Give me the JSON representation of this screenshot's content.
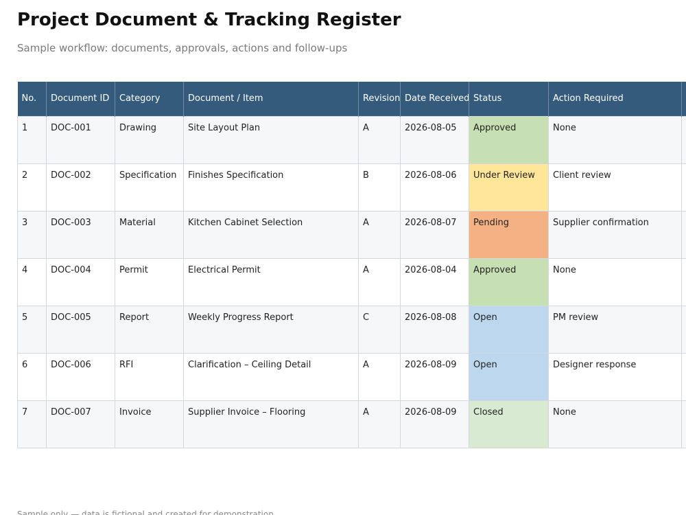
{
  "title": "Project Document & Tracking Register",
  "subtitle": "Sample workflow: documents, approvals, actions and follow-ups",
  "table": {
    "headers": {
      "no": "No.",
      "doc_id": "Document ID",
      "category": "Category",
      "item": "Document / Item",
      "revision": "Revision",
      "date_received": "Date Received",
      "status": "Status",
      "action": "Action Required"
    },
    "rows": [
      {
        "no": "1",
        "doc_id": "DOC-001",
        "category": "Drawing",
        "item": "Site Layout Plan",
        "revision": "A",
        "date_received": "2026-08-05",
        "status": "Approved",
        "action": "None"
      },
      {
        "no": "2",
        "doc_id": "DOC-002",
        "category": "Specification",
        "item": "Finishes Specification",
        "revision": "B",
        "date_received": "2026-08-06",
        "status": "Under Review",
        "action": "Client review"
      },
      {
        "no": "3",
        "doc_id": "DOC-003",
        "category": "Material",
        "item": "Kitchen Cabinet Selection",
        "revision": "A",
        "date_received": "2026-08-07",
        "status": "Pending",
        "action": "Supplier confirmation"
      },
      {
        "no": "4",
        "doc_id": "DOC-004",
        "category": "Permit",
        "item": "Electrical Permit",
        "revision": "A",
        "date_received": "2026-08-04",
        "status": "Approved",
        "action": "None"
      },
      {
        "no": "5",
        "doc_id": "DOC-005",
        "category": "Report",
        "item": "Weekly Progress Report",
        "revision": "C",
        "date_received": "2026-08-08",
        "status": "Open",
        "action": "PM review"
      },
      {
        "no": "6",
        "doc_id": "DOC-006",
        "category": "RFI",
        "item": "Clarification – Ceiling Detail",
        "revision": "A",
        "date_received": "2026-08-09",
        "status": "Open",
        "action": "Designer response"
      },
      {
        "no": "7",
        "doc_id": "DOC-007",
        "category": "Invoice",
        "item": "Supplier Invoice – Flooring",
        "revision": "A",
        "date_received": "2026-08-09",
        "status": "Closed",
        "action": "None"
      }
    ]
  },
  "status_colors": {
    "Approved": "#c6e0b4",
    "Under Review": "#ffe699",
    "Pending": "#f4b183",
    "Open": "#bdd7ee",
    "Closed": "#d9ead3"
  },
  "footnote": "Sample only — data is fictional and created for demonstration"
}
